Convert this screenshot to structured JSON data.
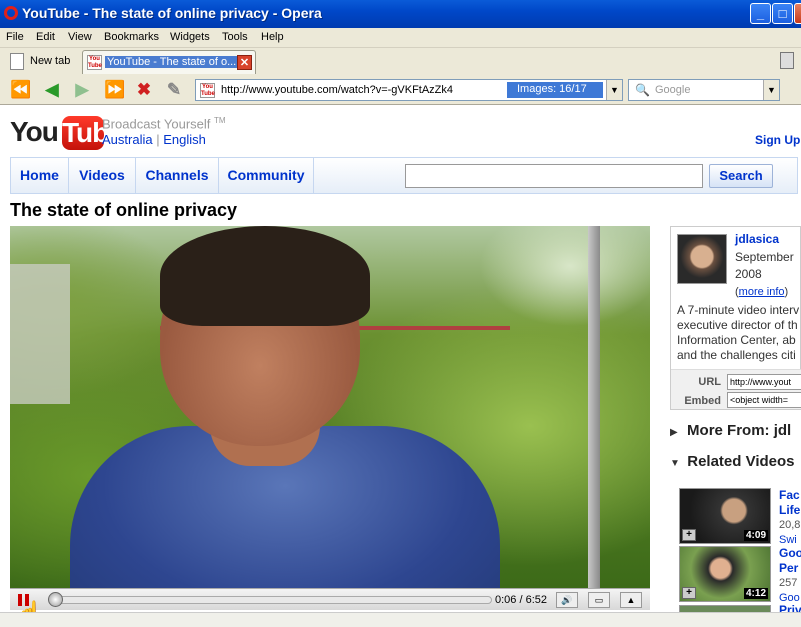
{
  "window": {
    "title": "YouTube - The state of online privacy - Opera"
  },
  "menu": [
    "File",
    "Edit",
    "View",
    "Bookmarks",
    "Widgets",
    "Tools",
    "Help"
  ],
  "tabs": {
    "new_tab": "New tab",
    "active": "YouTube - The state of o..."
  },
  "address": {
    "url": "http://www.youtube.com/watch?v=-gVKFtAzZk4",
    "images": "Images:  16/17"
  },
  "search_box": {
    "placeholder": "Google"
  },
  "yt": {
    "tagline": "Broadcast Yourself",
    "tm": "TM",
    "country": "Australia",
    "language": "English",
    "signup": "Sign Up",
    "nav": [
      "Home",
      "Videos",
      "Channels",
      "Community"
    ],
    "search_btn": "Search",
    "video_title": "The state of online privacy"
  },
  "player": {
    "time": "0:06 / 6:52",
    "progress": 0.015
  },
  "uploader": {
    "name": "jdlasica",
    "date_line1": "September",
    "date_line2": "2008",
    "more_info": "more info",
    "desc": [
      "A 7-minute video interv",
      "executive director of th",
      "Information Center, ab",
      "and the challenges citi"
    ],
    "url_label": "URL",
    "url_value": "http://www.yout",
    "embed_label": "Embed",
    "embed_value": "<object width="
  },
  "sections": {
    "more_from": "More From: jdl",
    "related": "Related Videos"
  },
  "related": [
    {
      "duration": "4:09",
      "title1": "Fac",
      "title2": "Life",
      "views": "20,8",
      "user": "Swi"
    },
    {
      "duration": "4:12",
      "title1": "Goo",
      "title2": "Per",
      "views": "257",
      "user": "Goo"
    },
    {
      "duration": "",
      "title1": "Priv",
      "title2": "",
      "views": "",
      "user": ""
    }
  ]
}
